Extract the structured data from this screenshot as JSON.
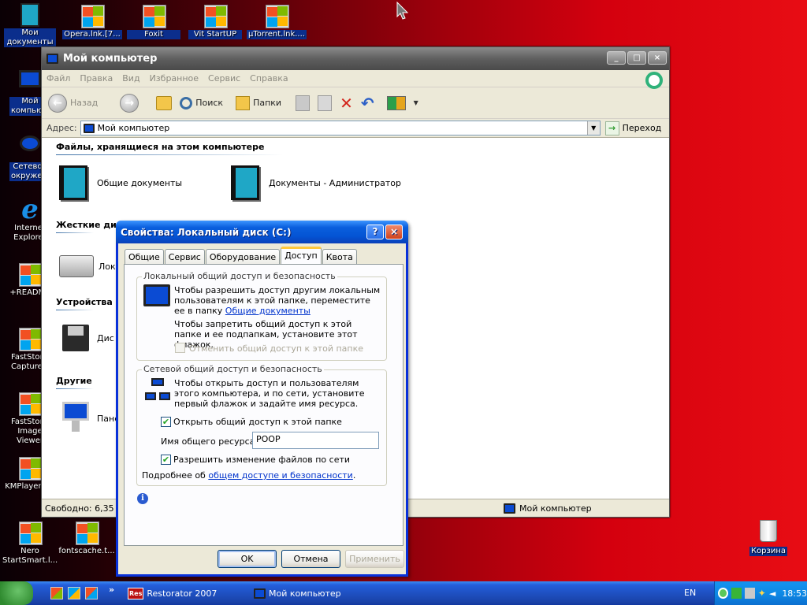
{
  "desktop": {
    "icons": [
      {
        "label": "Мои документы",
        "short": "Мои\nдокументы"
      },
      {
        "label": "Opera.lnk.[7..."
      },
      {
        "label": "Foxit Reader.lnk.[..."
      },
      {
        "label": "Vit StartUP Manager.lnk..."
      },
      {
        "label": "µTorrent.lnk...."
      },
      {
        "label": "Мой компьютер"
      },
      {
        "label": "Сетевое окружение"
      },
      {
        "label": "Internet Explorer"
      },
      {
        "label": "+README"
      },
      {
        "label": "FastStone Capture.lnk"
      },
      {
        "label": "FastStone Image Viewer"
      },
      {
        "label": "KMPlayer.lnk"
      },
      {
        "label": "Nero StartSmart.l..."
      },
      {
        "label": "fontscache.t..."
      },
      {
        "label": "Корзина"
      }
    ]
  },
  "explorer": {
    "title": "Мой компьютер",
    "menu": [
      "Файл",
      "Правка",
      "Вид",
      "Избранное",
      "Сервис",
      "Справка"
    ],
    "toolbar": {
      "back": "Назад",
      "search": "Поиск",
      "folders": "Папки"
    },
    "address_label": "Адрес:",
    "address_value": "Мой компьютер",
    "go_label": "Переход",
    "sections": {
      "stored_files": "Файлы, хранящиеся на этом компьютере",
      "hard_disks": "Жесткие дис",
      "devices": "Устройства с",
      "other": "Другие"
    },
    "items": {
      "shared_docs": "Общие документы",
      "admin_docs": "Документы - Администратор",
      "local_disk": "Лока",
      "floppy": "Дис",
      "control_panel": "Пане"
    },
    "status_left": "Свободно: 6,35 ГБ",
    "status_right": "Мой компьютер"
  },
  "dialog": {
    "title": "Свойства: Локальный диск (C:)",
    "tabs": [
      "Общие",
      "Сервис",
      "Оборудование",
      "Доступ",
      "Квота"
    ],
    "active_tab": "Доступ",
    "local_group": {
      "label": "Локальный общий доступ и безопасность",
      "text1": "Чтобы разрешить доступ другим локальным пользователям к этой папке, переместите ее в папку",
      "text1_link": "Общие документы",
      "text2": "Чтобы запретить общий доступ к этой папке и ее подпапкам, установите этот флажок.",
      "checkbox": "Отменить общий доступ к этой папке"
    },
    "network_group": {
      "label": "Сетевой общий доступ и безопасность",
      "text": "Чтобы открыть доступ и пользователям этого компьютера, и по сети, установите первый флажок и задайте имя ресурса.",
      "share_checkbox": "Открыть общий доступ к этой папке",
      "share_name_label": "Имя общего ресурса:",
      "share_name_value": "POOP",
      "allow_checkbox": "Разрешить изменение файлов по сети",
      "more_prefix": "Подробнее об",
      "more_link": "общем доступе и безопасности",
      "more_suffix": "."
    },
    "buttons": {
      "ok": "OK",
      "cancel": "Отмена",
      "apply": "Применить"
    }
  },
  "taskbar": {
    "tasks": [
      "Restorator 2007",
      "Мой компьютер"
    ],
    "res_badge": "Res",
    "language": "EN",
    "clock": "18:53"
  }
}
